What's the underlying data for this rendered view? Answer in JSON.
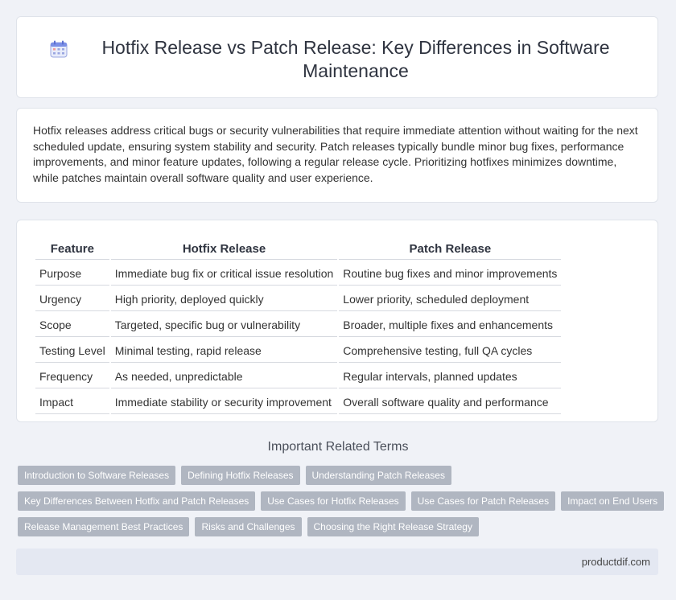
{
  "header": {
    "title": "Hotfix Release vs Patch Release: Key Differences in Software Maintenance",
    "icon": "calendar-icon"
  },
  "intro": {
    "text": "Hotfix releases address critical bugs or security vulnerabilities that require immediate attention without waiting for the next scheduled update, ensuring system stability and security. Patch releases typically bundle minor bug fixes, performance improvements, and minor feature updates, following a regular release cycle. Prioritizing hotfixes minimizes downtime, while patches maintain overall software quality and user experience."
  },
  "table": {
    "headers": [
      "Feature",
      "Hotfix Release",
      "Patch Release"
    ],
    "rows": [
      [
        "Purpose",
        "Immediate bug fix or critical issue resolution",
        "Routine bug fixes and minor improvements"
      ],
      [
        "Urgency",
        "High priority, deployed quickly",
        "Lower priority, scheduled deployment"
      ],
      [
        "Scope",
        "Targeted, specific bug or vulnerability",
        "Broader, multiple fixes and enhancements"
      ],
      [
        "Testing Level",
        "Minimal testing, rapid release",
        "Comprehensive testing, full QA cycles"
      ],
      [
        "Frequency",
        "As needed, unpredictable",
        "Regular intervals, planned updates"
      ],
      [
        "Impact",
        "Immediate stability or security improvement",
        "Overall software quality and performance"
      ]
    ]
  },
  "related": {
    "title": "Important Related Terms",
    "rows": [
      [
        "Introduction to Software Releases",
        "Defining Hotfix Releases",
        "Understanding Patch Releases"
      ],
      [
        "Key Differences Between Hotfix and Patch Releases",
        "Use Cases for Hotfix Releases",
        "Use Cases for Patch Releases",
        "Impact on End Users"
      ],
      [
        "Release Management Best Practices",
        "Risks and Challenges",
        "Choosing the Right Release Strategy"
      ]
    ]
  },
  "footer": {
    "text": "productdif.com"
  },
  "colors": {
    "background": "#f0f2f7",
    "tag": "#b0b6c1",
    "footer": "#e4e8f2"
  }
}
